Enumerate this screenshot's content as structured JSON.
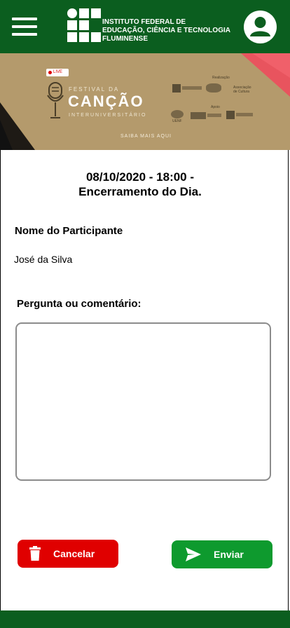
{
  "header": {
    "institution_line1": "INSTITUTO FEDERAL DE",
    "institution_line2": "EDUCAÇÃO, CIÊNCIA E TECNOLOGIA",
    "institution_line3": "FLUMINENSE",
    "menu_icon": "hamburger-menu-icon",
    "profile_icon": "user-avatar-icon",
    "bg_color": "#0b5e1f"
  },
  "banner": {
    "live": "LIVE",
    "festival_small": "FESTIVAL DA",
    "festival_big": "CANÇÃO",
    "festival_sub": "INTERUNIVERSITÁRIO",
    "cta": "SAIBA MAIS AQUI",
    "realizacao": "Realização",
    "apoio": "Apoio",
    "sponsor_1": "Associação de Cultura",
    "sponsor_2": "UENF"
  },
  "event": {
    "datetime": "08/10/2020 - 18:00 -",
    "title": "Encerramento do Dia."
  },
  "form": {
    "participant_label": "Nome do Participante",
    "participant_value": "José da Silva",
    "question_label": "Pergunta ou comentário:",
    "question_value": ""
  },
  "actions": {
    "cancel_label": "Cancelar",
    "cancel_icon": "trash-icon",
    "send_label": "Enviar",
    "send_icon": "send-icon",
    "cancel_color": "#e00000",
    "send_color": "#0e9a2e"
  }
}
